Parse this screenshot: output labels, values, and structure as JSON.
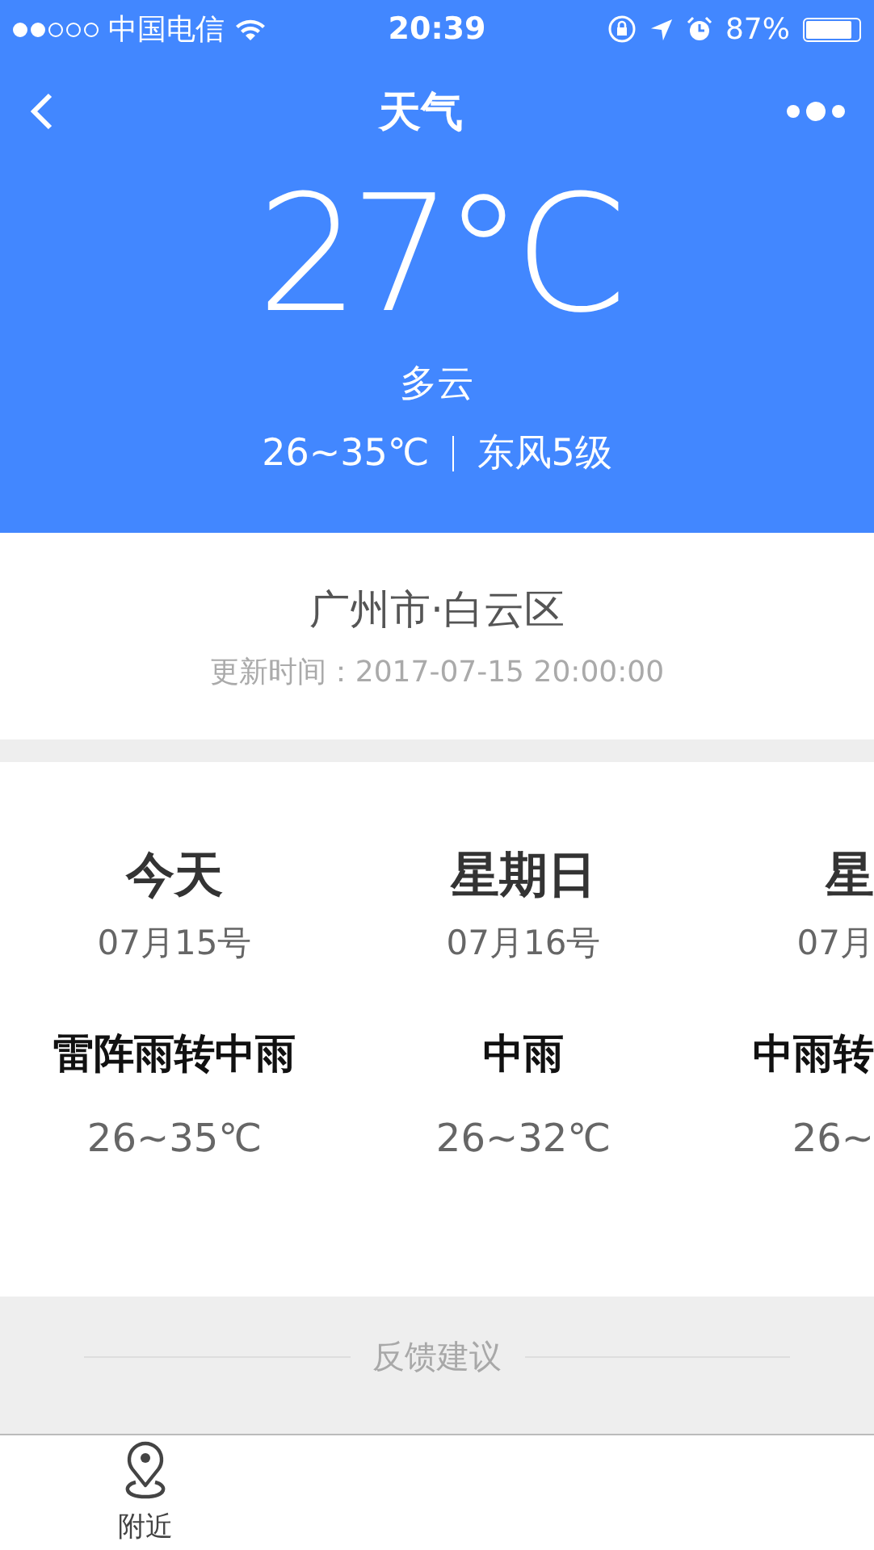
{
  "status_bar": {
    "signal_dots": [
      {
        "filled": true
      },
      {
        "filled": true
      },
      {
        "filled": false
      },
      {
        "filled": false
      },
      {
        "filled": false
      }
    ],
    "carrier": "中国电信",
    "time": "20:39",
    "battery": "87%"
  },
  "nav": {
    "title": "天气"
  },
  "current": {
    "temperature": "27°C",
    "condition": "多云",
    "range": "26~35℃",
    "wind": "东风5级"
  },
  "location": {
    "city": "广州市·白云区",
    "updated": "更新时间：2017-07-15 20:00:00"
  },
  "forecast": [
    {
      "day": "今天",
      "date": "07月15号",
      "weather": "雷阵雨转中雨",
      "range": "26~35℃",
      "cut": false
    },
    {
      "day": "星期日",
      "date": "07月16号",
      "weather": "中雨",
      "range": "26~32℃",
      "cut": false
    },
    {
      "day": "星",
      "date": "07月",
      "weather": "中雨转",
      "range": "26~",
      "cut": true
    }
  ],
  "feedback": "反馈建议",
  "tab_bar": [
    {
      "label": "附近",
      "selected": false
    }
  ]
}
